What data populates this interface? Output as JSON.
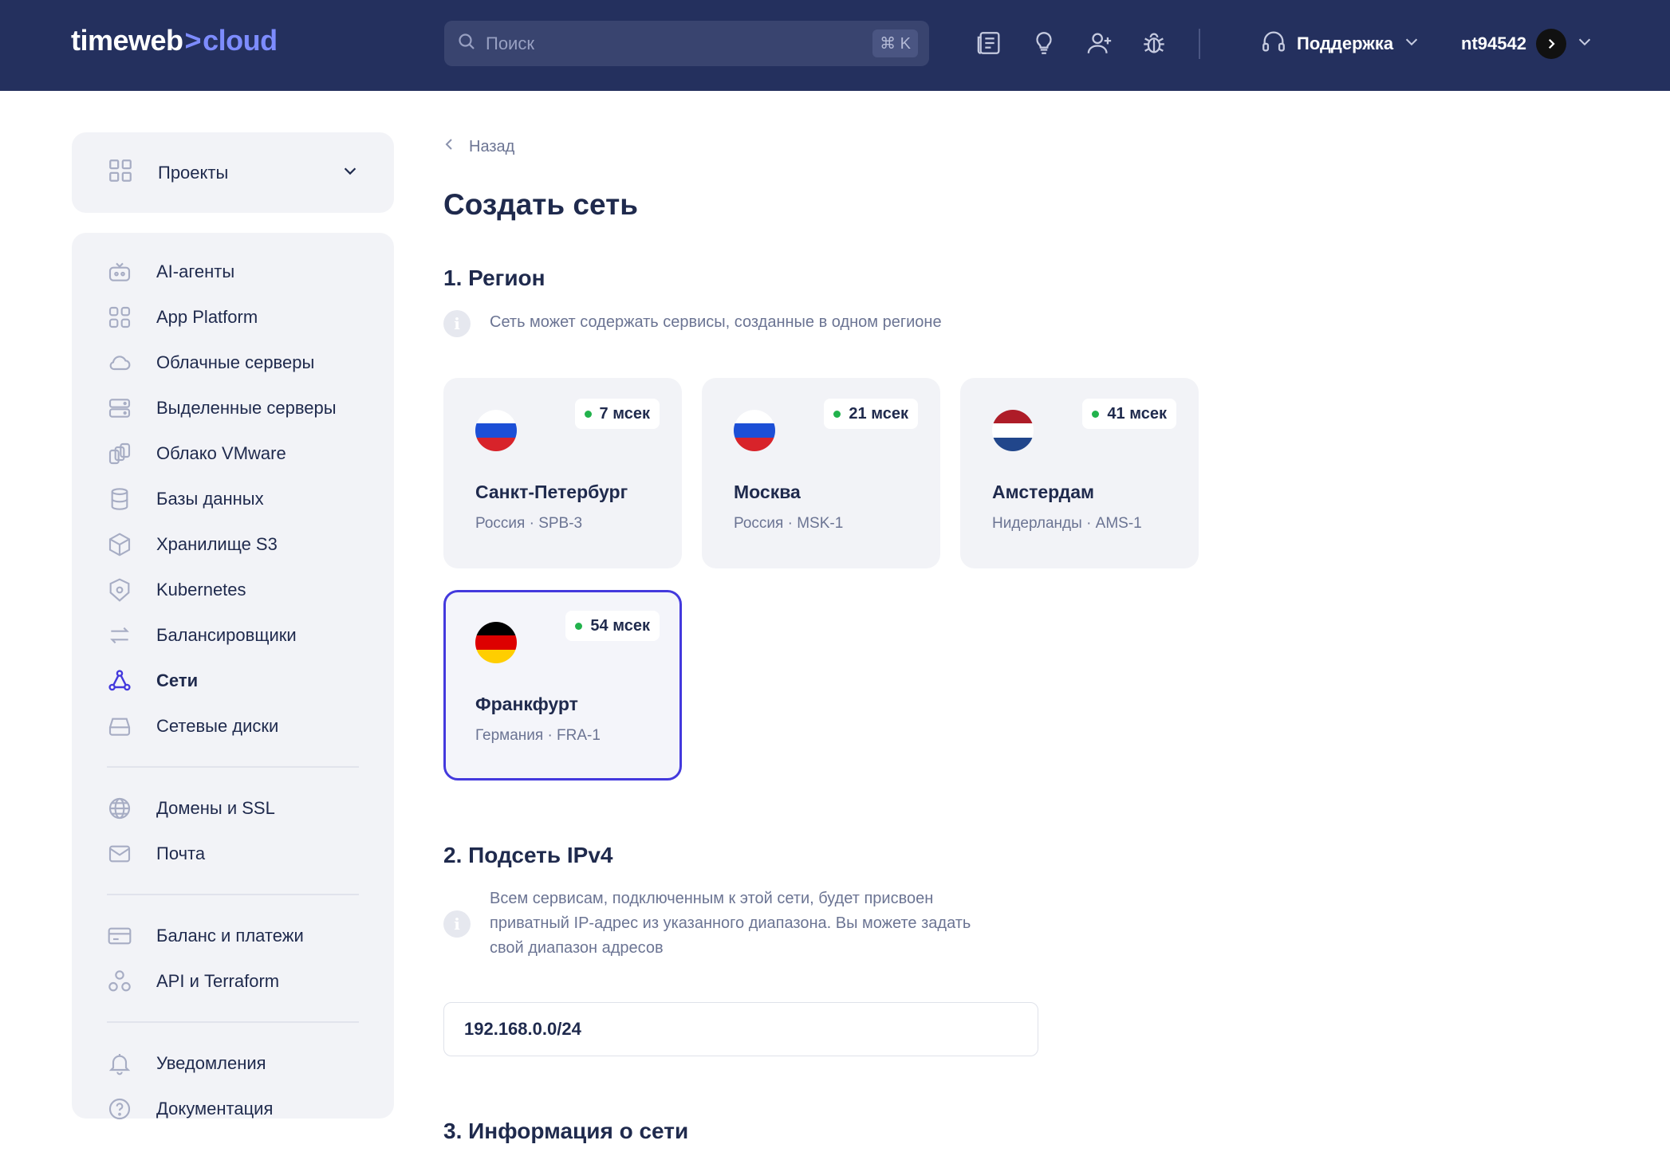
{
  "header": {
    "logo_left": "timeweb",
    "logo_sep": ">",
    "logo_right": "cloud",
    "search_placeholder": "Поиск",
    "search_shortcut": "⌘ K",
    "icons": [
      "news-icon",
      "lightbulb-icon",
      "add-user-icon",
      "bug-icon"
    ],
    "support_label": "Поддержка",
    "account_label": "nt94542"
  },
  "sidebar": {
    "projects_label": "Проекты",
    "groups": [
      [
        {
          "label": "AI-агенты",
          "icon": "robot-icon"
        },
        {
          "label": "App Platform",
          "icon": "app-grid-icon"
        },
        {
          "label": "Облачные серверы",
          "icon": "cloud-icon"
        },
        {
          "label": "Выделенные серверы",
          "icon": "server-icon"
        },
        {
          "label": "Облако VMware",
          "icon": "vmware-icon"
        },
        {
          "label": "Базы данных",
          "icon": "database-icon"
        },
        {
          "label": "Хранилище S3",
          "icon": "cube-icon"
        },
        {
          "label": "Kubernetes",
          "icon": "kubernetes-icon"
        },
        {
          "label": "Балансировщики",
          "icon": "arrows-icon"
        },
        {
          "label": "Сети",
          "icon": "network-icon",
          "active": true
        },
        {
          "label": "Сетевые диски",
          "icon": "disk-icon"
        }
      ],
      [
        {
          "label": "Домены и SSL",
          "icon": "globe-icon"
        },
        {
          "label": "Почта",
          "icon": "mail-icon"
        }
      ],
      [
        {
          "label": "Баланс и платежи",
          "icon": "card-icon"
        },
        {
          "label": "API и Terraform",
          "icon": "api-icon"
        }
      ],
      [
        {
          "label": "Уведомления",
          "icon": "bell-icon"
        },
        {
          "label": "Документация",
          "icon": "help-icon"
        }
      ]
    ]
  },
  "main": {
    "back_label": "Назад",
    "title": "Создать сеть",
    "region_section": {
      "title": "1. Регион",
      "info": "Сеть может содержать сервисы, созданные в одном регионе"
    },
    "regions": [
      {
        "name": "Санкт-Петербург",
        "sub": "Россия · SPB-3",
        "ping": "7 мсек",
        "flag": [
          "#ffffff",
          "#1c4fd6",
          "#d8232a"
        ],
        "selected": false
      },
      {
        "name": "Москва",
        "sub": "Россия · MSK-1",
        "ping": "21 мсек",
        "flag": [
          "#ffffff",
          "#1c4fd6",
          "#d8232a"
        ],
        "selected": false
      },
      {
        "name": "Амстердам",
        "sub": "Нидерланды · AMS-1",
        "ping": "41 мсек",
        "flag": [
          "#ae1c28",
          "#ffffff",
          "#21468b"
        ],
        "selected": false
      },
      {
        "name": "Франкфурт",
        "sub": "Германия · FRA-1",
        "ping": "54 мсек",
        "flag": [
          "#000000",
          "#dd0000",
          "#ffce00"
        ],
        "selected": true
      }
    ],
    "subnet_section": {
      "title": "2. Подсеть IPv4",
      "info_lines": [
        "Всем сервисам, подключенным к этой сети, будет присвоен",
        "приватный IP-адрес из указанного диапазона. Вы можете задать",
        "свой диапазон адресов"
      ],
      "value": "192.168.0.0/24"
    },
    "info_section": {
      "title": "3. Информация о сети"
    }
  },
  "colors": {
    "header_bg": "#24305e",
    "accent": "#4339dd",
    "card_bg": "#f2f3f7",
    "ping_dot": "#22b24c"
  }
}
